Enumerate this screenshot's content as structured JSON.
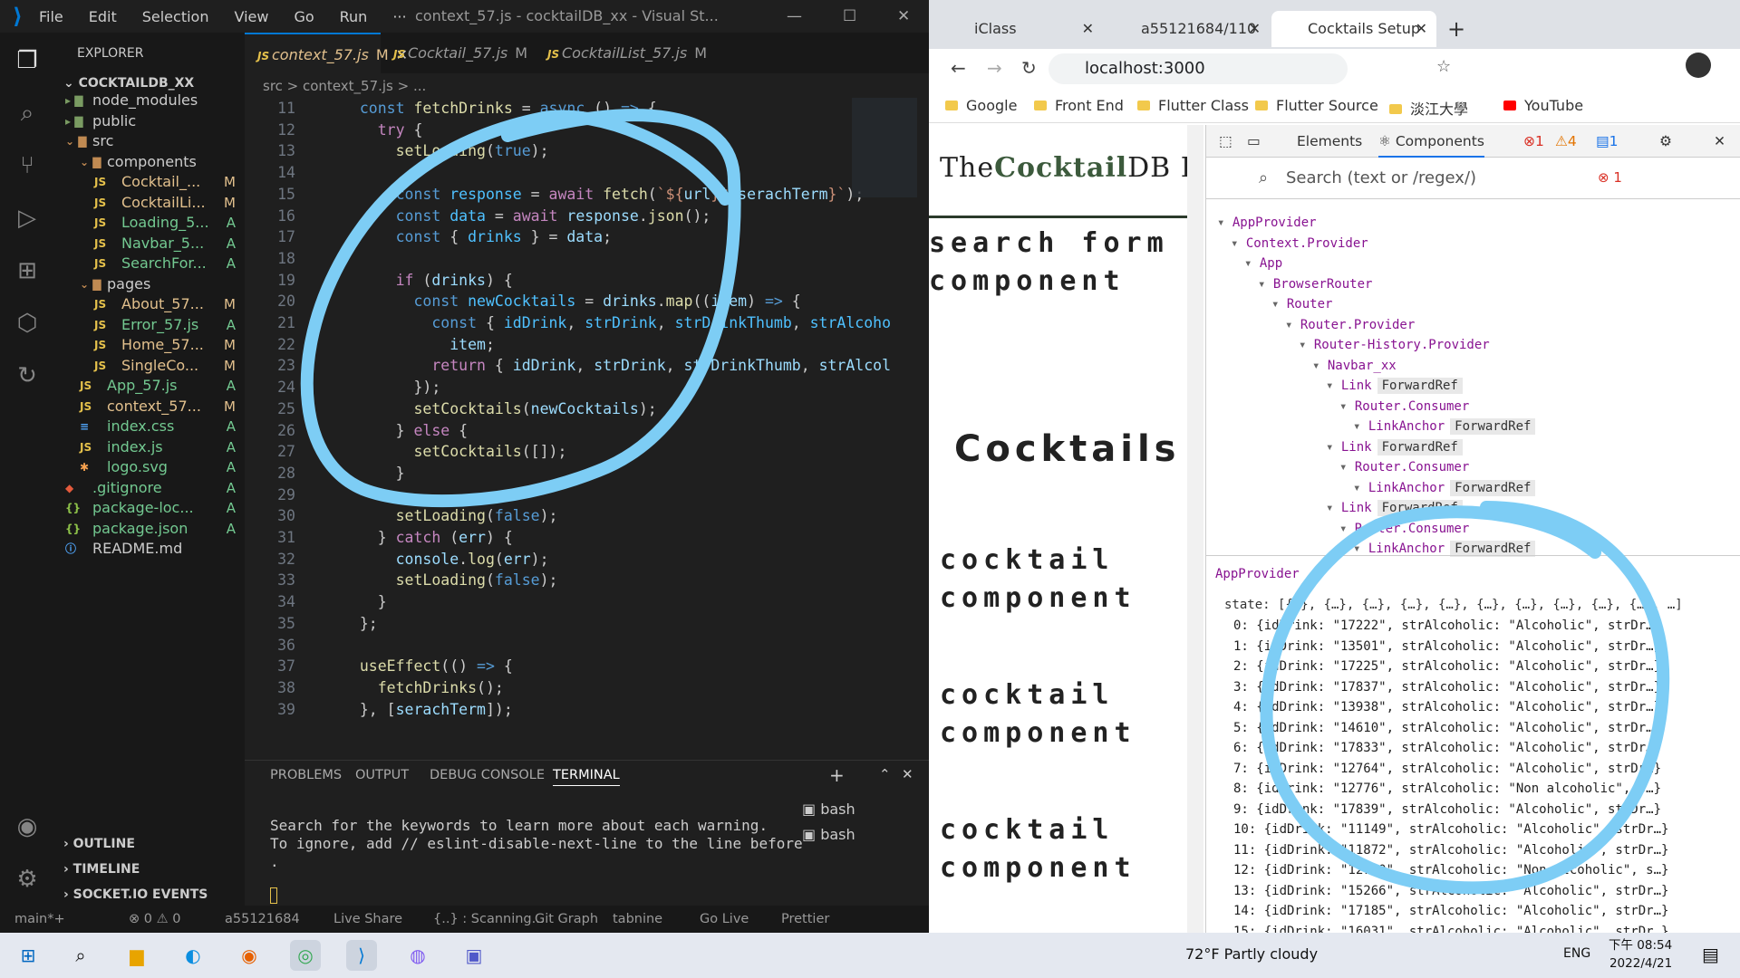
{
  "vscode": {
    "menu": [
      "File",
      "Edit",
      "Selection",
      "View",
      "Go",
      "Run",
      "···"
    ],
    "window_title": "context_57.js - cocktailDB_xx - Visual St...",
    "explorer_title": "EXPLORER",
    "root": "COCKTAILDB_XX",
    "tree": [
      {
        "name": "node_modules",
        "status": "",
        "indent": 1,
        "kind": "folder"
      },
      {
        "name": "public",
        "status": "",
        "indent": 1,
        "kind": "folder"
      },
      {
        "name": "src",
        "status": "",
        "indent": 1,
        "kind": "folder-open"
      },
      {
        "name": "components",
        "status": "",
        "indent": 2,
        "kind": "folder-open"
      },
      {
        "name": "Cocktail_...",
        "status": "M",
        "indent": 3,
        "kind": "js"
      },
      {
        "name": "CocktailLi...",
        "status": "M",
        "indent": 3,
        "kind": "js"
      },
      {
        "name": "Loading_5...",
        "status": "A",
        "indent": 3,
        "kind": "js"
      },
      {
        "name": "Navbar_5...",
        "status": "A",
        "indent": 3,
        "kind": "js"
      },
      {
        "name": "SearchFor...",
        "status": "A",
        "indent": 3,
        "kind": "js"
      },
      {
        "name": "pages",
        "status": "",
        "indent": 2,
        "kind": "folder-open"
      },
      {
        "name": "About_57...",
        "status": "M",
        "indent": 3,
        "kind": "js"
      },
      {
        "name": "Error_57.js",
        "status": "A",
        "indent": 3,
        "kind": "js"
      },
      {
        "name": "Home_57...",
        "status": "M",
        "indent": 3,
        "kind": "js"
      },
      {
        "name": "SingleCo...",
        "status": "M",
        "indent": 3,
        "kind": "js"
      },
      {
        "name": "App_57.js",
        "status": "A",
        "indent": 2,
        "kind": "js"
      },
      {
        "name": "context_57...",
        "status": "M",
        "indent": 2,
        "kind": "js"
      },
      {
        "name": "index.css",
        "status": "A",
        "indent": 2,
        "kind": "css"
      },
      {
        "name": "index.js",
        "status": "A",
        "indent": 2,
        "kind": "js"
      },
      {
        "name": "logo.svg",
        "status": "A",
        "indent": 2,
        "kind": "svg"
      },
      {
        "name": ".gitignore",
        "status": "A",
        "indent": 1,
        "kind": "git"
      },
      {
        "name": "package-loc...",
        "status": "A",
        "indent": 1,
        "kind": "json"
      },
      {
        "name": "package.json",
        "status": "A",
        "indent": 1,
        "kind": "json"
      },
      {
        "name": "README.md",
        "status": "",
        "indent": 1,
        "kind": "info"
      }
    ],
    "outline_sections": [
      "OUTLINE",
      "TIMELINE",
      "SOCKET.IO EVENTS"
    ],
    "tabs": [
      {
        "label": "context_57.js",
        "status": "M"
      },
      {
        "label": "Cocktail_57.js",
        "status": "M"
      },
      {
        "label": "CocktailList_57.js",
        "status": "M"
      }
    ],
    "breadcrumb": "src  >  context_57.js  > ...",
    "code_lines": [
      {
        "n": "11",
        "html": "  <span class='kw'>const</span> <span class='fn'>fetchDrinks</span> = <span class='kw'>async</span> () <span class='kw'>=></span> {"
      },
      {
        "n": "12",
        "html": "    <span class='kw2'>try</span> {"
      },
      {
        "n": "13",
        "html": "      <span class='fn'>setLoading</span>(<span class='kw'>true</span>);"
      },
      {
        "n": "14",
        "html": ""
      },
      {
        "n": "15",
        "html": "      <span class='kw'>const</span> <span class='cst'>response</span> = <span class='kw2'>await</span> <span class='fn'>fetch</span>(<span class='str'>`${</span><span class='var'>url</span><span class='str'>}${</span><span class='var'>serachTerm</span><span class='str'>}`</span>);"
      },
      {
        "n": "16",
        "html": "      <span class='kw'>const</span> <span class='cst'>data</span> = <span class='kw2'>await</span> <span class='var'>response</span>.<span class='fn'>json</span>();"
      },
      {
        "n": "17",
        "html": "      <span class='kw'>const</span> { <span class='cst'>drinks</span> } = <span class='var'>data</span>;"
      },
      {
        "n": "18",
        "html": ""
      },
      {
        "n": "19",
        "html": "      <span class='kw2'>if</span> (<span class='var'>drinks</span>) {"
      },
      {
        "n": "20",
        "html": "        <span class='kw'>const</span> <span class='cst'>newCocktails</span> = <span class='var'>drinks</span>.<span class='fn'>map</span>((<span class='var'>item</span>) <span class='kw'>=></span> {"
      },
      {
        "n": "21",
        "html": "          <span class='kw'>const</span> { <span class='cst'>idDrink</span>, <span class='cst'>strDrink</span>, <span class='cst'>strDrinkThumb</span>, <span class='cst'>strAlcoho</span>"
      },
      {
        "n": "22",
        "html": "            <span class='var'>item</span>;"
      },
      {
        "n": "23",
        "html": "          <span class='kw2'>return</span> { <span class='var'>idDrink</span>, <span class='var'>strDrink</span>, <span class='var'>strDrinkThumb</span>, <span class='var'>strAlcol</span>"
      },
      {
        "n": "24",
        "html": "        });"
      },
      {
        "n": "25",
        "html": "        <span class='fn'>setCocktails</span>(<span class='var'>newCocktails</span>);"
      },
      {
        "n": "26",
        "html": "      } <span class='kw2'>else</span> {"
      },
      {
        "n": "27",
        "html": "        <span class='fn'>setCocktails</span>([]);"
      },
      {
        "n": "28",
        "html": "      }"
      },
      {
        "n": "29",
        "html": ""
      },
      {
        "n": "30",
        "html": "      <span class='fn'>setLoading</span>(<span class='kw'>false</span>);"
      },
      {
        "n": "31",
        "html": "    } <span class='kw2'>catch</span> (<span class='var'>err</span>) {"
      },
      {
        "n": "32",
        "html": "      <span class='var'>console</span>.<span class='fn'>log</span>(<span class='var'>err</span>);"
      },
      {
        "n": "33",
        "html": "      <span class='fn'>setLoading</span>(<span class='kw'>false</span>);"
      },
      {
        "n": "34",
        "html": "    }"
      },
      {
        "n": "35",
        "html": "  };"
      },
      {
        "n": "36",
        "html": ""
      },
      {
        "n": "37",
        "html": "  <span class='fn'>useEffect</span>(() <span class='kw'>=></span> {"
      },
      {
        "n": "38",
        "html": "    <span class='fn'>fetchDrinks</span>();"
      },
      {
        "n": "39",
        "html": "  }, [<span class='var'>serachTerm</span>]);"
      }
    ],
    "panel_tabs": [
      "PROBLEMS",
      "OUTPUT",
      "DEBUG CONSOLE",
      "TERMINAL"
    ],
    "terminal_lines": [
      "Search for the keywords to learn more about each warning.",
      "To ignore, add // eslint-disable-next-line to the line before",
      "."
    ],
    "terminal_instances": [
      "bash",
      "bash"
    ],
    "status_items": [
      "main*+",
      "⊗ 0 ⚠ 0",
      "a55121684",
      "Live Share",
      "{..} : Scanning...",
      "Git Graph",
      "tabnine",
      "Go Live",
      "Prettier"
    ]
  },
  "chrome": {
    "tabs": [
      "iClass",
      "a55121684/110",
      "Cocktails Setup"
    ],
    "url": "localhost:3000",
    "bookmarks": [
      "Google",
      "Front End",
      "Flutter Class",
      "Flutter Source",
      "淡江大學",
      "YouTube"
    ],
    "page": {
      "logo_prefix": "The",
      "logo_brand": "Cocktail",
      "logo_suffix": "DB H",
      "search_form": [
        "search form",
        "component"
      ],
      "heading": "Cocktails",
      "cocktail_items": [
        [
          "cocktail",
          "component"
        ],
        [
          "cocktail",
          "component"
        ],
        [
          "cocktail",
          "component"
        ]
      ]
    },
    "devtools": {
      "tabs": [
        "Elements",
        "Components"
      ],
      "error_count": "1",
      "warn_count": "4",
      "info_count": "1",
      "search_placeholder": "Search (text or /regex/)",
      "search_error": "1",
      "tree": [
        {
          "name": "AppProvider",
          "depth": 0
        },
        {
          "name": "Context.Provider",
          "depth": 1
        },
        {
          "name": "App",
          "depth": 2
        },
        {
          "name": "BrowserRouter",
          "depth": 3
        },
        {
          "name": "Router",
          "depth": 4
        },
        {
          "name": "Router.Provider",
          "depth": 5
        },
        {
          "name": "Router-History.Provider",
          "depth": 6
        },
        {
          "name": "Navbar_xx",
          "depth": 7
        },
        {
          "name": "Link",
          "depth": 8,
          "chip": "ForwardRef"
        },
        {
          "name": "Router.Consumer",
          "depth": 9
        },
        {
          "name": "LinkAnchor",
          "depth": 10,
          "chip": "ForwardRef"
        },
        {
          "name": "Link",
          "depth": 8,
          "chip": "ForwardRef"
        },
        {
          "name": "Router.Consumer",
          "depth": 9
        },
        {
          "name": "LinkAnchor",
          "depth": 10,
          "chip": "ForwardRef"
        },
        {
          "name": "Link",
          "depth": 8,
          "chip": "ForwardRef"
        },
        {
          "name": "Router.Consumer",
          "depth": 9
        },
        {
          "name": "LinkAnchor",
          "depth": 10,
          "chip": "ForwardRef"
        }
      ],
      "selected_component": "AppProvider",
      "state_header": "state: [{…}, {…}, {…}, {…}, {…}, {…}, {…}, {…}, {…}, {…}, …]",
      "state_rows": [
        "0: {idDrink: \"17222\", strAlcoholic: \"Alcoholic\", strDr…}",
        "1: {idDrink: \"13501\", strAlcoholic: \"Alcoholic\", strDr…}",
        "2: {idDrink: \"17225\", strAlcoholic: \"Alcoholic\", strDr…}",
        "3: {idDrink: \"17837\", strAlcoholic: \"Alcoholic\", strDr…}",
        "4: {idDrink: \"13938\", strAlcoholic: \"Alcoholic\", strDr…}",
        "5: {idDrink: \"14610\", strAlcoholic: \"Alcoholic\", strDr…}",
        "6: {idDrink: \"17833\", strAlcoholic: \"Alcoholic\", strDr…}",
        "7: {idDrink: \"12764\", strAlcoholic: \"Alcoholic\", strDr…}",
        "8: {idDrink: \"12776\", strAlcoholic: \"Non alcoholic\", s…}",
        "9: {idDrink: \"17839\", strAlcoholic: \"Alcoholic\", strDr…}",
        "10: {idDrink: \"11149\", strAlcoholic: \"Alcoholic\", strDr…}",
        "11: {idDrink: \"11872\", strAlcoholic: \"Alcoholic\", strDr…}",
        "12: {idDrink: \"12790\", strAlcoholic: \"Non alcoholic\", s…}",
        "13: {idDrink: \"15266\", strAlcoholic: \"Alcoholic\", strDr…}",
        "14: {idDrink: \"17185\", strAlcoholic: \"Alcoholic\", strDr…}",
        "15: {idDrink: \"16031\", strAlcoholic: \"Alcoholic\", strDr…}"
      ]
    }
  },
  "taskbar": {
    "weather": "72°F  Partly cloudy",
    "lang": "ENG",
    "ampm": "下午 08:54",
    "date": "2022/4/21"
  },
  "colors": {
    "annotation": "#7dcdf5",
    "accent": "#0078d4",
    "vs_bg": "#1e1e1e"
  }
}
